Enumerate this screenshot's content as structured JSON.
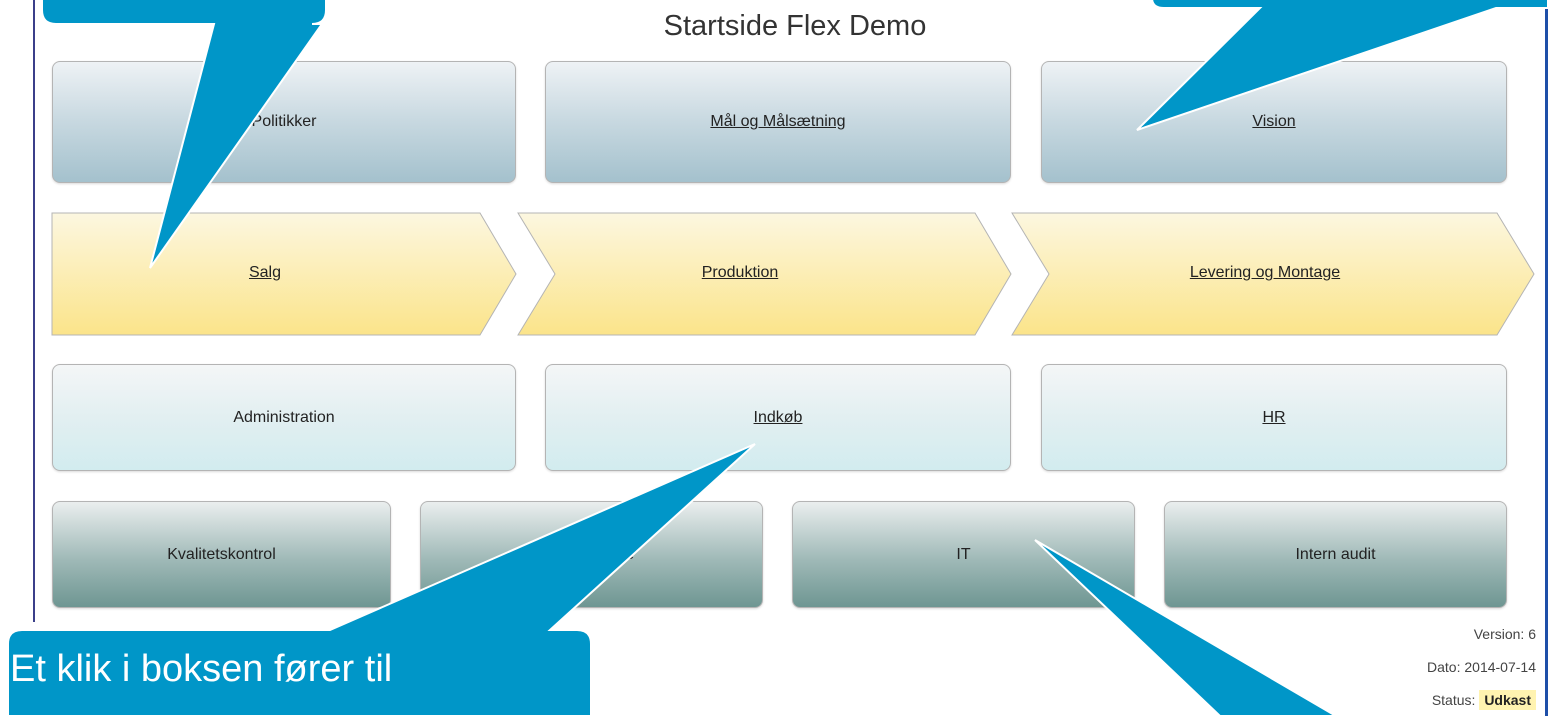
{
  "page": {
    "title": "Startside Flex Demo"
  },
  "row1": [
    {
      "label": "Politikker",
      "link": false
    },
    {
      "label": "Mål og Målsætning",
      "link": true
    },
    {
      "label": "Vision",
      "link": true
    }
  ],
  "process": [
    {
      "label": "Salg"
    },
    {
      "label": "Produktion"
    },
    {
      "label": "Levering og Montage"
    }
  ],
  "row3": [
    {
      "label": "Administration",
      "link": false
    },
    {
      "label": "Indkøb",
      "link": true
    },
    {
      "label": "HR",
      "link": true
    }
  ],
  "row4": [
    {
      "label": "Kvalitetskontrol"
    },
    {
      "label": "Uddannelse"
    },
    {
      "label": "IT"
    },
    {
      "label": "Intern audit"
    }
  ],
  "meta": {
    "version_label": "Version:",
    "version": "6",
    "date_label": "Dato:",
    "date": "2014-07-14",
    "status_label": "Status:",
    "status": "Udkast"
  },
  "callout": {
    "text": "Et klik i boksen fører til"
  },
  "colors": {
    "callout": "#0096c8",
    "process_fill": "#fbe89a",
    "frame": "#3b3f8a"
  }
}
